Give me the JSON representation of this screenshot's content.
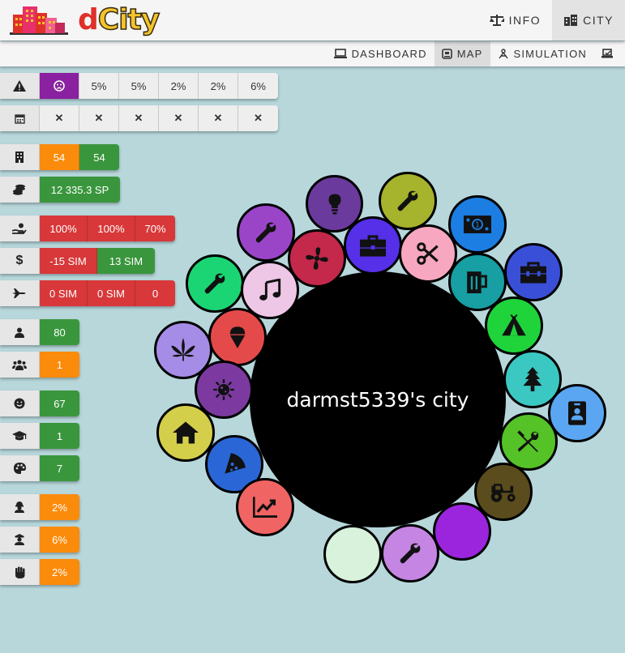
{
  "header": {
    "logo_text_d": "d",
    "logo_text_city": "City",
    "nav": [
      {
        "label": "INFO",
        "icon": "balance-scale-icon",
        "active": false
      },
      {
        "label": "CITY",
        "icon": "city-icon",
        "active": true
      }
    ]
  },
  "subnav": [
    {
      "label": "DASHBOARD",
      "icon": "laptop-icon",
      "active": false
    },
    {
      "label": "MAP",
      "icon": "map-icon",
      "active": true
    },
    {
      "label": "SIMULATION",
      "icon": "simulation-icon",
      "active": false
    },
    {
      "label": "",
      "icon": "inbox-icon",
      "active": false
    }
  ],
  "stats": {
    "alerts": {
      "icon": "warning-icon",
      "face_icon": "sad-face-icon",
      "values": [
        "5%",
        "5%",
        "2%",
        "2%",
        "6%"
      ]
    },
    "calendar": {
      "icon": "calendar-icon",
      "values": [
        "✕",
        "✕",
        "✕",
        "✕",
        "✕",
        "✕"
      ]
    },
    "buildings": {
      "icon": "building-icon",
      "values": [
        "54",
        "54"
      ]
    },
    "balance": {
      "icon": "coins-icon",
      "value": "12 335.3 SP"
    },
    "taxes": {
      "icon": "hand-coin-icon",
      "values": [
        "100%",
        "100%",
        "70%"
      ]
    },
    "income": {
      "icon": "dollar-icon",
      "values": [
        "-15 SIM",
        "13 SIM"
      ]
    },
    "import": {
      "icon": "plane-icon",
      "values": [
        "0 SIM",
        "0 SIM",
        "0"
      ]
    },
    "population": {
      "icon": "person-icon",
      "value": "80"
    },
    "groups": {
      "icon": "users-icon",
      "value": "1"
    },
    "happiness": {
      "icon": "smile-icon",
      "value": "67"
    },
    "education": {
      "icon": "graduation-cap-icon",
      "value": "1"
    },
    "culture": {
      "icon": "palette-icon",
      "value": "7"
    },
    "crime": {
      "icon": "thief-icon",
      "value": "2%"
    },
    "police": {
      "icon": "officer-icon",
      "value": "6%"
    },
    "protest": {
      "icon": "fist-icon",
      "value": "2%"
    }
  },
  "city": {
    "name": "darmst5339's city",
    "colors": {
      "core": "#000000"
    },
    "buildings": [
      {
        "icon": "lightbulb-icon",
        "color": "#6a3a9c"
      },
      {
        "icon": "wrench-icon",
        "color": "#a6b32c"
      },
      {
        "icon": "money-bill-icon",
        "color": "#1c7ee2"
      },
      {
        "icon": "toolbox-icon",
        "color": "#3a4fd8"
      },
      {
        "icon": "wrench-icon",
        "color": "#9a45c8"
      },
      {
        "icon": "fan-icon",
        "color": "#c4284a"
      },
      {
        "icon": "briefcase-icon",
        "color": "#5530e8"
      },
      {
        "icon": "scissors-icon",
        "color": "#f7a7c0"
      },
      {
        "icon": "beer-icon",
        "color": "#179fa3"
      },
      {
        "icon": "wrench-icon",
        "color": "#1bd574"
      },
      {
        "icon": "music-icon",
        "color": "#eec6e6"
      },
      {
        "icon": "tent-icon",
        "color": "#1fd43a"
      },
      {
        "icon": "ice-cream-icon",
        "color": "#e54a4a"
      },
      {
        "icon": "cannabis-leaf-icon",
        "color": "#a58ce6"
      },
      {
        "icon": "tree-icon",
        "color": "#3cc8c2"
      },
      {
        "icon": "virus-icon",
        "color": "#7c3aa0"
      },
      {
        "icon": "id-badge-icon",
        "color": "#5aa6f2"
      },
      {
        "icon": "home-icon",
        "color": "#d4cf4a"
      },
      {
        "icon": "tools-icon",
        "color": "#55c228"
      },
      {
        "icon": "pizza-icon",
        "color": "#2a66d6"
      },
      {
        "icon": "tractor-icon",
        "color": "#5a4c1c"
      },
      {
        "icon": "chart-line-icon",
        "color": "#f16464"
      },
      {
        "icon": "",
        "color": "#9b25dc"
      },
      {
        "icon": "",
        "color": "#d8f2dc"
      },
      {
        "icon": "wrench-icon",
        "color": "#c486e2"
      }
    ]
  }
}
